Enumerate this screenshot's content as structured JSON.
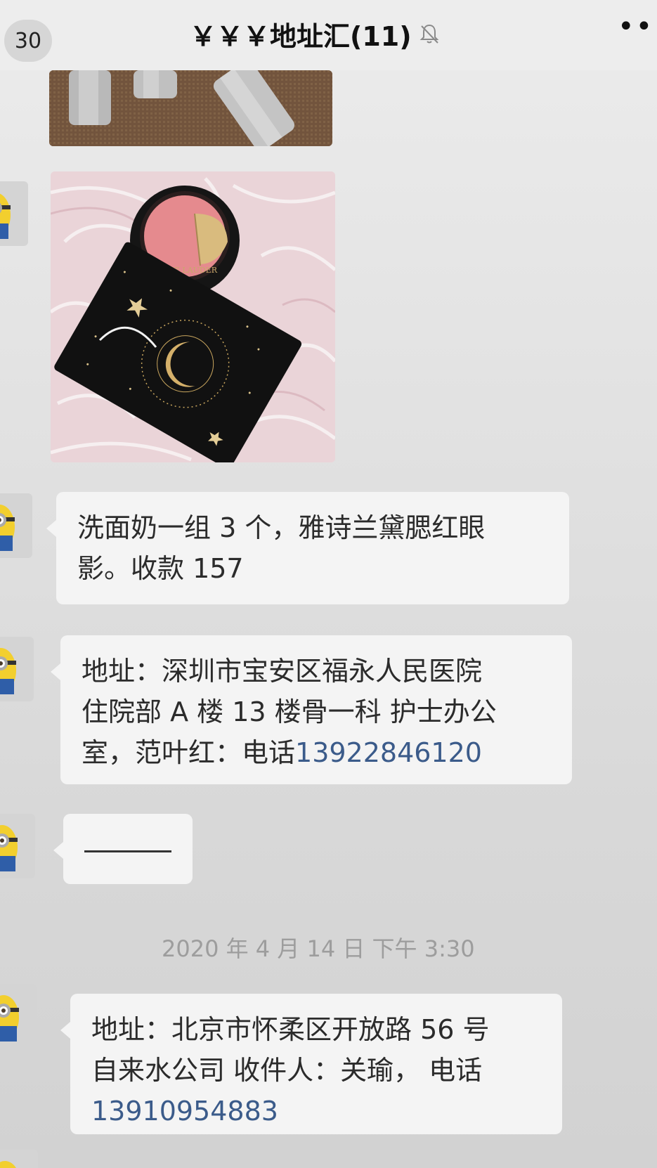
{
  "header": {
    "back_count": "30",
    "title": "￥￥￥地址汇(11)",
    "more": "•••"
  },
  "images": {
    "blush_brand": "ESTEE LAUDER"
  },
  "messages": [
    {
      "lines": [
        "洗面奶一组 3 个，雅诗兰黛腮红眼",
        "影。收款 157"
      ]
    },
    {
      "lines": [
        "地址：深圳市宝安区福永人民医院",
        "住院部 A 楼 13 楼骨一科  护士办公",
        "室，范叶红：电话"
      ],
      "phone": "13922846120"
    },
    {
      "lines": []
    },
    {
      "lines": [
        "地址：北京市怀柔区开放路 56 号",
        "自来水公司  收件人：关瑜，  电话"
      ],
      "phone": "13910954883"
    }
  ],
  "timestamp": "2020 年 4 月 14 日  下午 3:30",
  "icons": {
    "mute": "bell-slash-icon",
    "avatar": "minion-avatar-icon"
  }
}
